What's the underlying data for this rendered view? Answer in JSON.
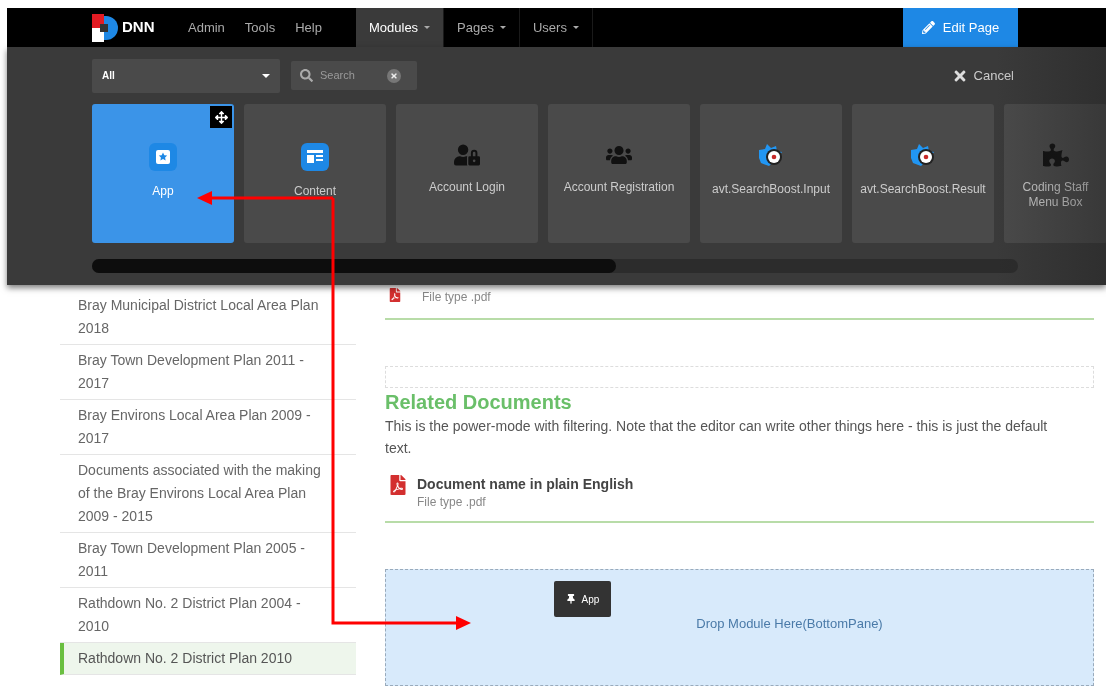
{
  "nav": {
    "logo": "DNN",
    "items": [
      {
        "label": "Admin",
        "has_menu": false,
        "selected": false
      },
      {
        "label": "Tools",
        "has_menu": false,
        "selected": false
      },
      {
        "label": "Help",
        "has_menu": false,
        "selected": false
      },
      {
        "label": "Modules",
        "has_menu": true,
        "selected": true
      },
      {
        "label": "Pages",
        "has_menu": true,
        "selected": false
      },
      {
        "label": "Users",
        "has_menu": true,
        "selected": false
      }
    ],
    "edit_button": "Edit Page"
  },
  "filter": {
    "category": "All",
    "search_placeholder": "Search",
    "cancel": "Cancel"
  },
  "modules": [
    {
      "label": "App",
      "kind": "app",
      "selected": true
    },
    {
      "label": "Content",
      "kind": "content",
      "selected": false
    },
    {
      "label": "Account Login",
      "kind": "login",
      "selected": false
    },
    {
      "label": "Account Registration",
      "kind": "registration",
      "selected": false
    },
    {
      "label": "avt.SearchBoost.Input",
      "kind": "search",
      "selected": false
    },
    {
      "label": "avt.SearchBoost.Result",
      "kind": "search",
      "selected": false
    },
    {
      "label": "Coding Staff Menu Box",
      "kind": "plugin",
      "selected": false
    }
  ],
  "sidebar": {
    "items": [
      {
        "label": "Bray Municipal District Local Area Plan 2018",
        "selected": false
      },
      {
        "label": "Bray Town Development Plan 2011 - 2017",
        "selected": false
      },
      {
        "label": "Bray Environs Local Area Plan 2009 - 2017",
        "selected": false
      },
      {
        "label": "Documents associated with the making of the Bray Environs Local Area Plan 2009 - 2015",
        "selected": false
      },
      {
        "label": "Bray Town Development Plan 2005 - 2011",
        "selected": false
      },
      {
        "label": "Rathdown No. 2 District Plan 2004 - 2010",
        "selected": false
      },
      {
        "label": "Rathdown No. 2 District Plan 2010",
        "selected": true
      }
    ]
  },
  "content": {
    "top_file_type": "File type .pdf",
    "heading": "Related Documents",
    "description": "This is the power-mode with filtering. Note that the editor can write other things here - this is just the default text.",
    "documents": [
      {
        "name": "Document name in plain English",
        "file_type": "File type .pdf"
      }
    ]
  },
  "drop_zone": {
    "label": "Drop Module Here(BottomPane)",
    "dragged_module": "App"
  }
}
